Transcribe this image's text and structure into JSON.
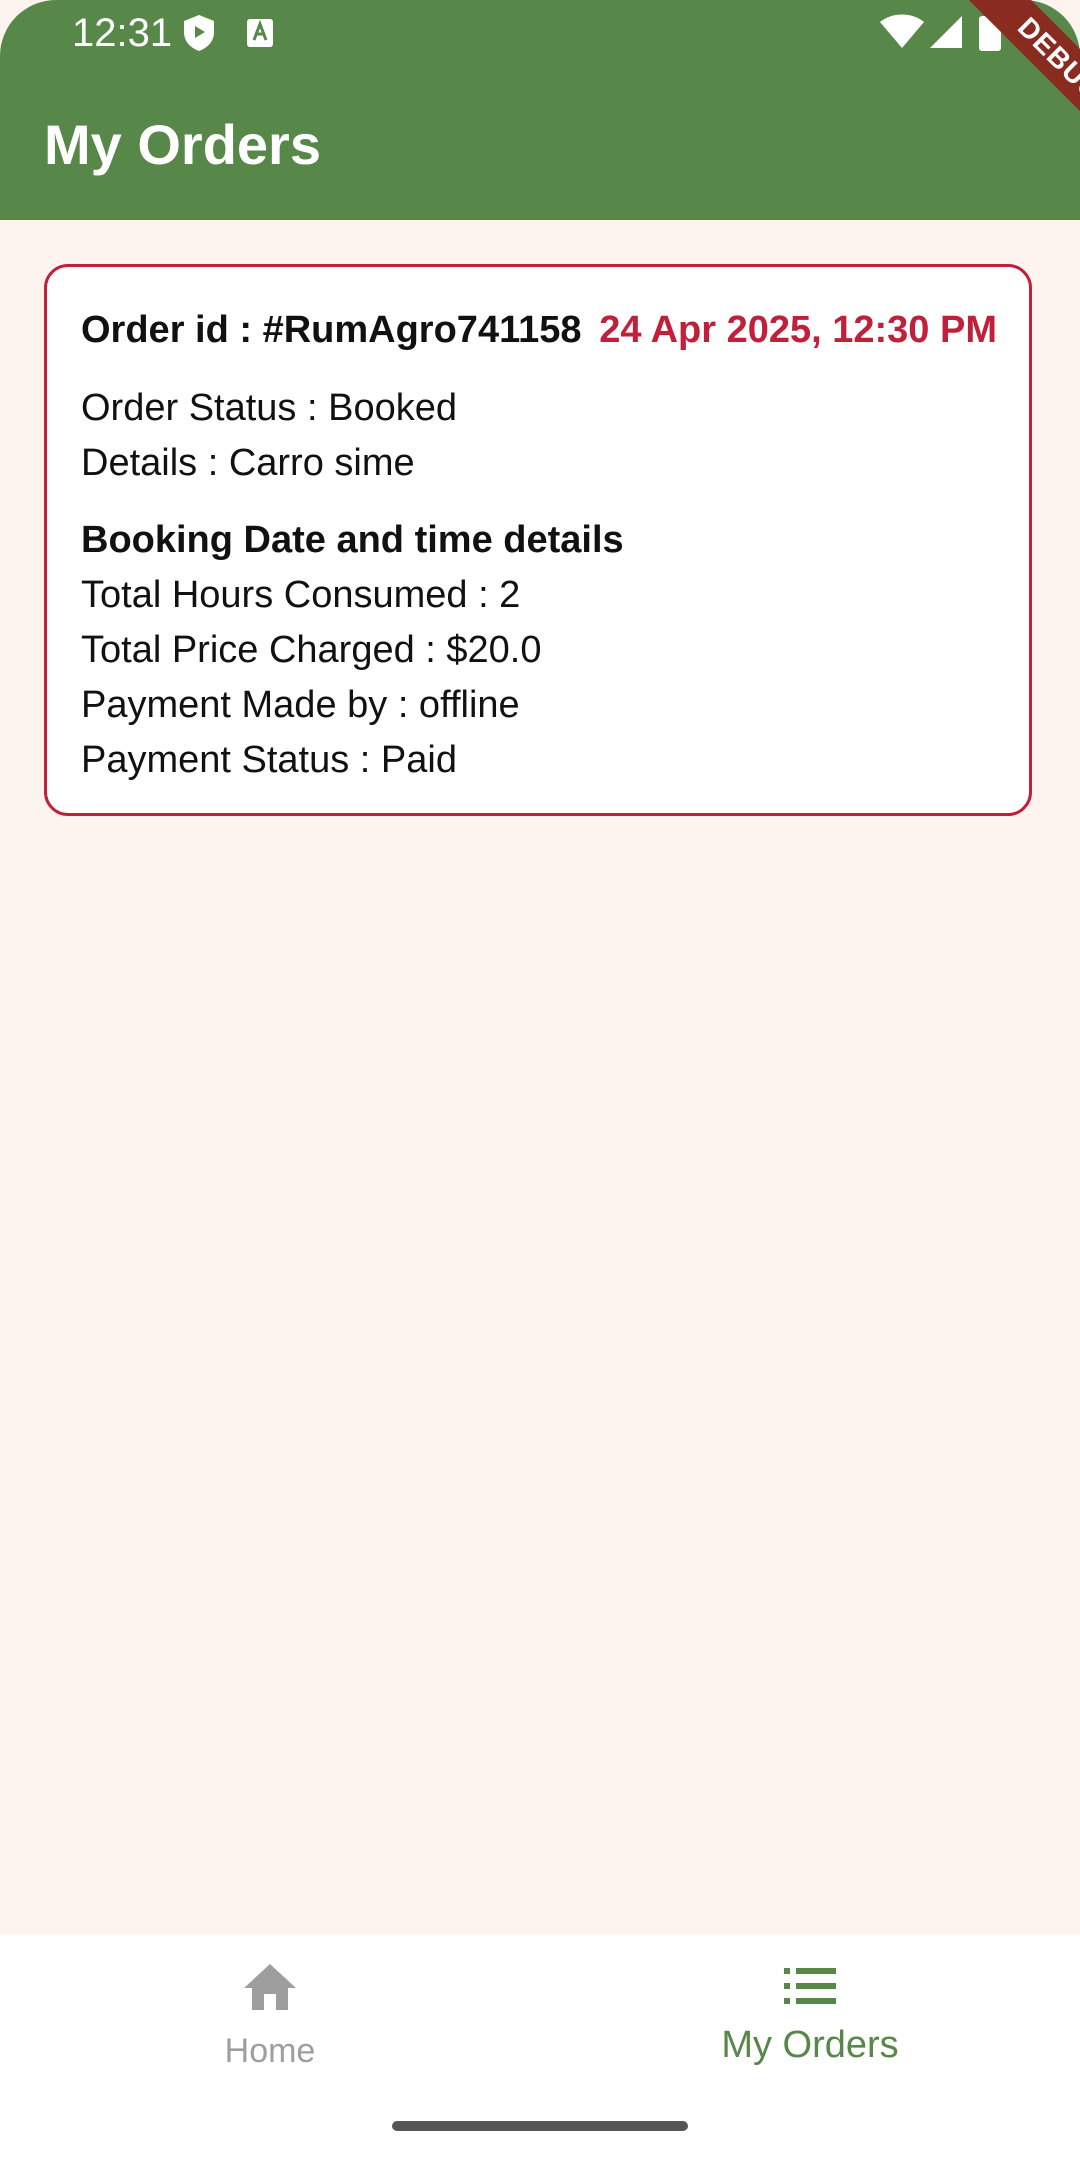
{
  "status_bar": {
    "time": "12:31"
  },
  "app_bar": {
    "title": "My Orders",
    "debug_label": "DEBUG"
  },
  "order": {
    "id_text": "Order id : #RumAgro741158",
    "date_text": "24 Apr 2025, 12:30 PM",
    "status_text": "Order Status : Booked",
    "details_text": "Details : Carro sime",
    "booking_heading": "Booking Date and time details",
    "hours_text": "Total Hours Consumed : 2",
    "price_text": "Total Price Charged : $20.0",
    "payment_by_text": "Payment Made by : offline",
    "payment_status_text": "Payment Status : Paid"
  },
  "bottom_nav": {
    "items": [
      {
        "label": "Home",
        "icon": "home-icon",
        "selected": false
      },
      {
        "label": "My Orders",
        "icon": "list-icon",
        "selected": true
      }
    ]
  },
  "colors": {
    "primary": "#58874a",
    "accent": "#c0203a",
    "background": "#fdf4f0",
    "inactive": "#9e9e9e"
  }
}
